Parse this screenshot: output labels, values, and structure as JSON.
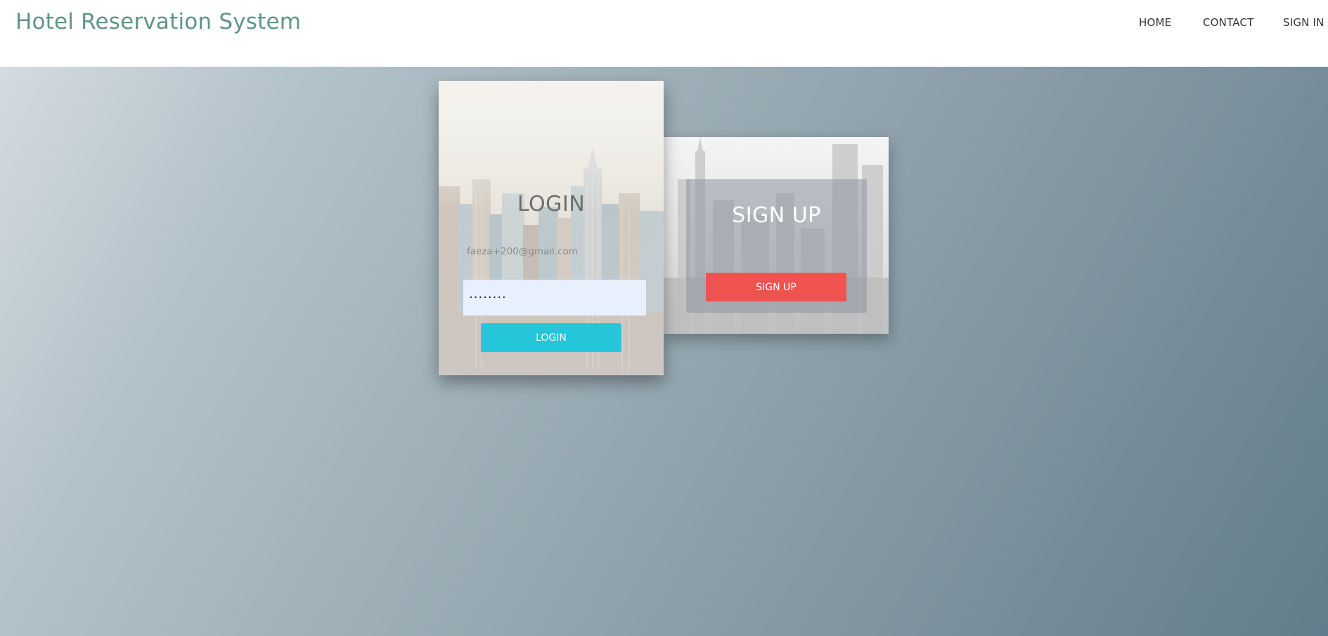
{
  "navbar": {
    "brand": "Hotel Reservation System",
    "links": [
      "HOME",
      "CONTACT",
      "SIGN IN"
    ]
  },
  "login": {
    "title": "LOGIN",
    "email": "faeza+200@gmail.com",
    "password": "········",
    "button": "LOGIN"
  },
  "signup": {
    "title": "SIGN UP",
    "button": "SIGN UP"
  },
  "colors": {
    "brand": "#5f9585",
    "login_button": "#26c6da",
    "signup_button": "#ef5350",
    "input_bg": "#e8f0fe"
  }
}
